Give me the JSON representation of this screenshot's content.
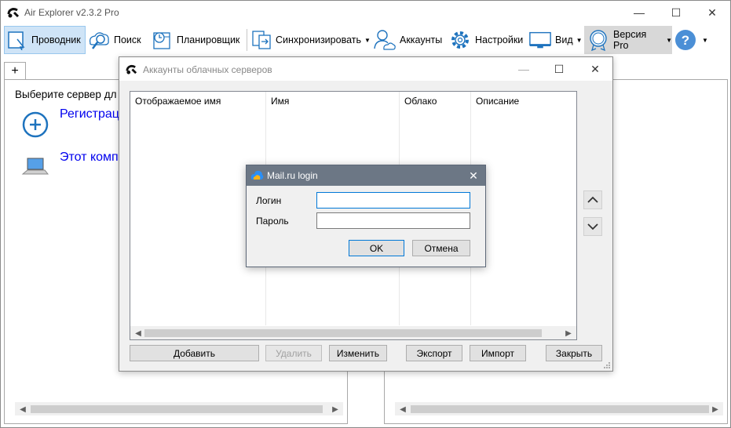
{
  "app": {
    "title": "Air Explorer v2.3.2 Pro",
    "controls": {
      "minimize": "—",
      "maximize": "☐",
      "close": "✕"
    }
  },
  "toolbar": {
    "explorer": "Проводник",
    "search": "Поиск",
    "scheduler": "Планировщик",
    "sync": "Синхронизировать",
    "accounts": "Аккаунты",
    "settings": "Настройки",
    "view": "Вид",
    "pro": "Версия Pro",
    "help": "?"
  },
  "left_pane": {
    "tab_add": "+",
    "prompt": "Выберите сервер дл",
    "items": [
      {
        "label": "Регистрац",
        "icon": "plus-circle-icon"
      },
      {
        "label": "Этот комп",
        "icon": "laptop-icon"
      }
    ]
  },
  "accounts_dialog": {
    "title": "Аккаунты облачных серверов",
    "columns": [
      "Отображаемое имя",
      "Имя",
      "Облако",
      "Описание"
    ],
    "buttons": {
      "add": "Добавить",
      "delete": "Удалить",
      "edit": "Изменить",
      "export": "Экспорт",
      "import": "Импорт",
      "close": "Закрыть"
    }
  },
  "login_dialog": {
    "title": "Mail.ru login",
    "login_label": "Логин",
    "password_label": "Пароль",
    "login_value": "",
    "password_value": "",
    "ok": "OK",
    "cancel": "Отмена"
  },
  "colors": {
    "accent": "#0078d7",
    "active_tool": "#cfe4f7",
    "login_titlebar": "#6c7785",
    "link": "#0000ee"
  }
}
